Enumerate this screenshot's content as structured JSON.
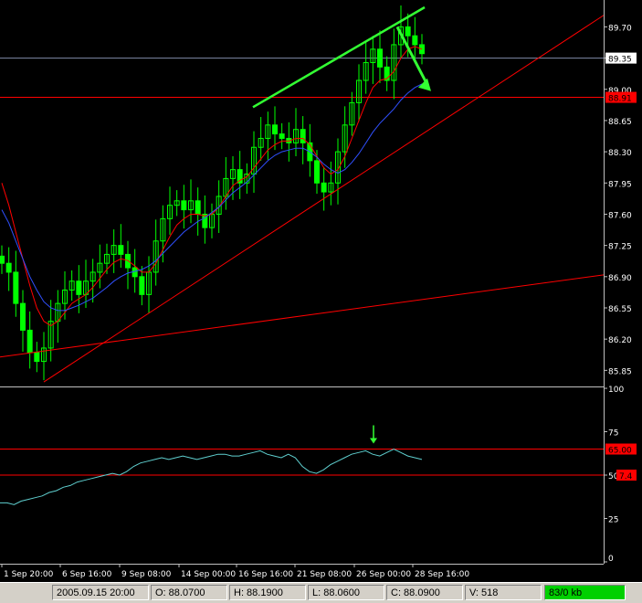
{
  "chart_data": {
    "type": "candlestick",
    "price_panel": {
      "ylim": [
        85.7,
        89.95
      ],
      "y_ticks": [
        "89.70",
        "89.35",
        "89.00",
        "88.65",
        "88.30",
        "87.95",
        "87.60",
        "87.25",
        "86.90",
        "86.55",
        "86.20",
        "85.85"
      ],
      "current_price_label": "89.35",
      "current_price_value": 89.35,
      "support_level_label": "88.91",
      "support_level_value": 88.91,
      "close_series": [
        87.05,
        86.95,
        86.6,
        86.3,
        86.05,
        85.95,
        86.1,
        86.4,
        86.6,
        86.75,
        86.85,
        86.7,
        86.85,
        86.95,
        87.05,
        87.15,
        87.25,
        87.15,
        87.0,
        86.9,
        86.7,
        86.95,
        87.3,
        87.55,
        87.7,
        87.75,
        87.65,
        87.75,
        87.6,
        87.45,
        87.6,
        87.8,
        88.0,
        88.1,
        87.95,
        88.05,
        88.35,
        88.45,
        88.6,
        88.5,
        88.45,
        88.4,
        88.55,
        88.4,
        88.2,
        87.95,
        87.85,
        87.95,
        88.3,
        88.6,
        88.85,
        89.1,
        89.3,
        89.45,
        89.25,
        89.1,
        89.5,
        89.7,
        89.6,
        89.5,
        89.4
      ],
      "ma_fast": [
        87.95,
        87.7,
        87.4,
        87.1,
        86.8,
        86.55,
        86.4,
        86.35,
        86.4,
        86.5,
        86.6,
        86.65,
        86.7,
        86.78,
        86.88,
        86.98,
        87.06,
        87.1,
        87.08,
        87.02,
        86.95,
        86.95,
        87.05,
        87.2,
        87.35,
        87.48,
        87.55,
        87.6,
        87.6,
        87.58,
        87.6,
        87.68,
        87.8,
        87.92,
        87.98,
        88.02,
        88.12,
        88.22,
        88.32,
        88.38,
        88.42,
        88.42,
        88.45,
        88.45,
        88.38,
        88.25,
        88.12,
        88.05,
        88.1,
        88.25,
        88.45,
        88.65,
        88.85,
        89.02,
        89.1,
        89.12,
        89.2,
        89.35,
        89.45,
        89.48,
        89.45
      ],
      "ma_slow": [
        87.65,
        87.5,
        87.3,
        87.1,
        86.9,
        86.75,
        86.62,
        86.55,
        86.52,
        86.52,
        86.55,
        86.58,
        86.62,
        86.66,
        86.72,
        86.78,
        86.85,
        86.9,
        86.94,
        86.96,
        86.98,
        87.02,
        87.08,
        87.16,
        87.24,
        87.32,
        87.4,
        87.46,
        87.52,
        87.56,
        87.62,
        87.68,
        87.76,
        87.84,
        87.9,
        87.96,
        88.04,
        88.12,
        88.2,
        88.26,
        88.3,
        88.32,
        88.34,
        88.34,
        88.3,
        88.24,
        88.16,
        88.1,
        88.06,
        88.1,
        88.18,
        88.28,
        88.4,
        88.52,
        88.62,
        88.7,
        88.78,
        88.88,
        88.96,
        89.02,
        89.06
      ],
      "ma_slow_start_index": 12
    },
    "oscillator_panel": {
      "ylim": [
        0,
        100
      ],
      "y_ticks": [
        "100",
        "75",
        "50",
        "25",
        "0"
      ],
      "level_high_label": "65.00",
      "level_high_value": 65,
      "level_low_label": "7.4",
      "level_low_value": 50,
      "values": [
        34,
        34,
        33,
        35,
        36,
        37,
        38,
        40,
        41,
        43,
        44,
        46,
        47,
        48,
        49,
        50,
        51,
        50,
        52,
        55,
        57,
        58,
        59,
        60,
        59,
        60,
        61,
        60,
        59,
        60,
        61,
        62,
        62,
        61,
        61,
        62,
        63,
        64,
        62,
        61,
        60,
        62,
        60,
        55,
        52,
        51,
        53,
        56,
        58,
        60,
        62,
        63,
        64,
        62,
        61,
        63,
        65,
        63,
        61,
        60,
        59
      ]
    },
    "x_ticks": [
      "1 Sep 20:00",
      "6 Sep 16:00",
      "9 Sep 08:00",
      "14 Sep 00:00",
      "16 Sep 16:00",
      "21 Sep 08:00",
      "26 Sep 00:00",
      "28 Sep 16:00"
    ],
    "colors": {
      "background": "#000000",
      "candles": "#00ff00",
      "ma_fast": "#ff0000",
      "ma_slow": "#3050ff",
      "oscillator": "#5fcfcf",
      "trend_lines": "#ff0000",
      "resistance_arrow": "#33ff33",
      "price_line": "#7f8aa8",
      "axis_text": "#ffffff"
    }
  },
  "status_bar": {
    "date": "2005.09.15 20:00",
    "open": "O: 88.0700",
    "high": "H: 88.1900",
    "low": "L: 88.0600",
    "close": "C: 88.0900",
    "volume": "V: 518",
    "traffic": "83/0 kb"
  }
}
